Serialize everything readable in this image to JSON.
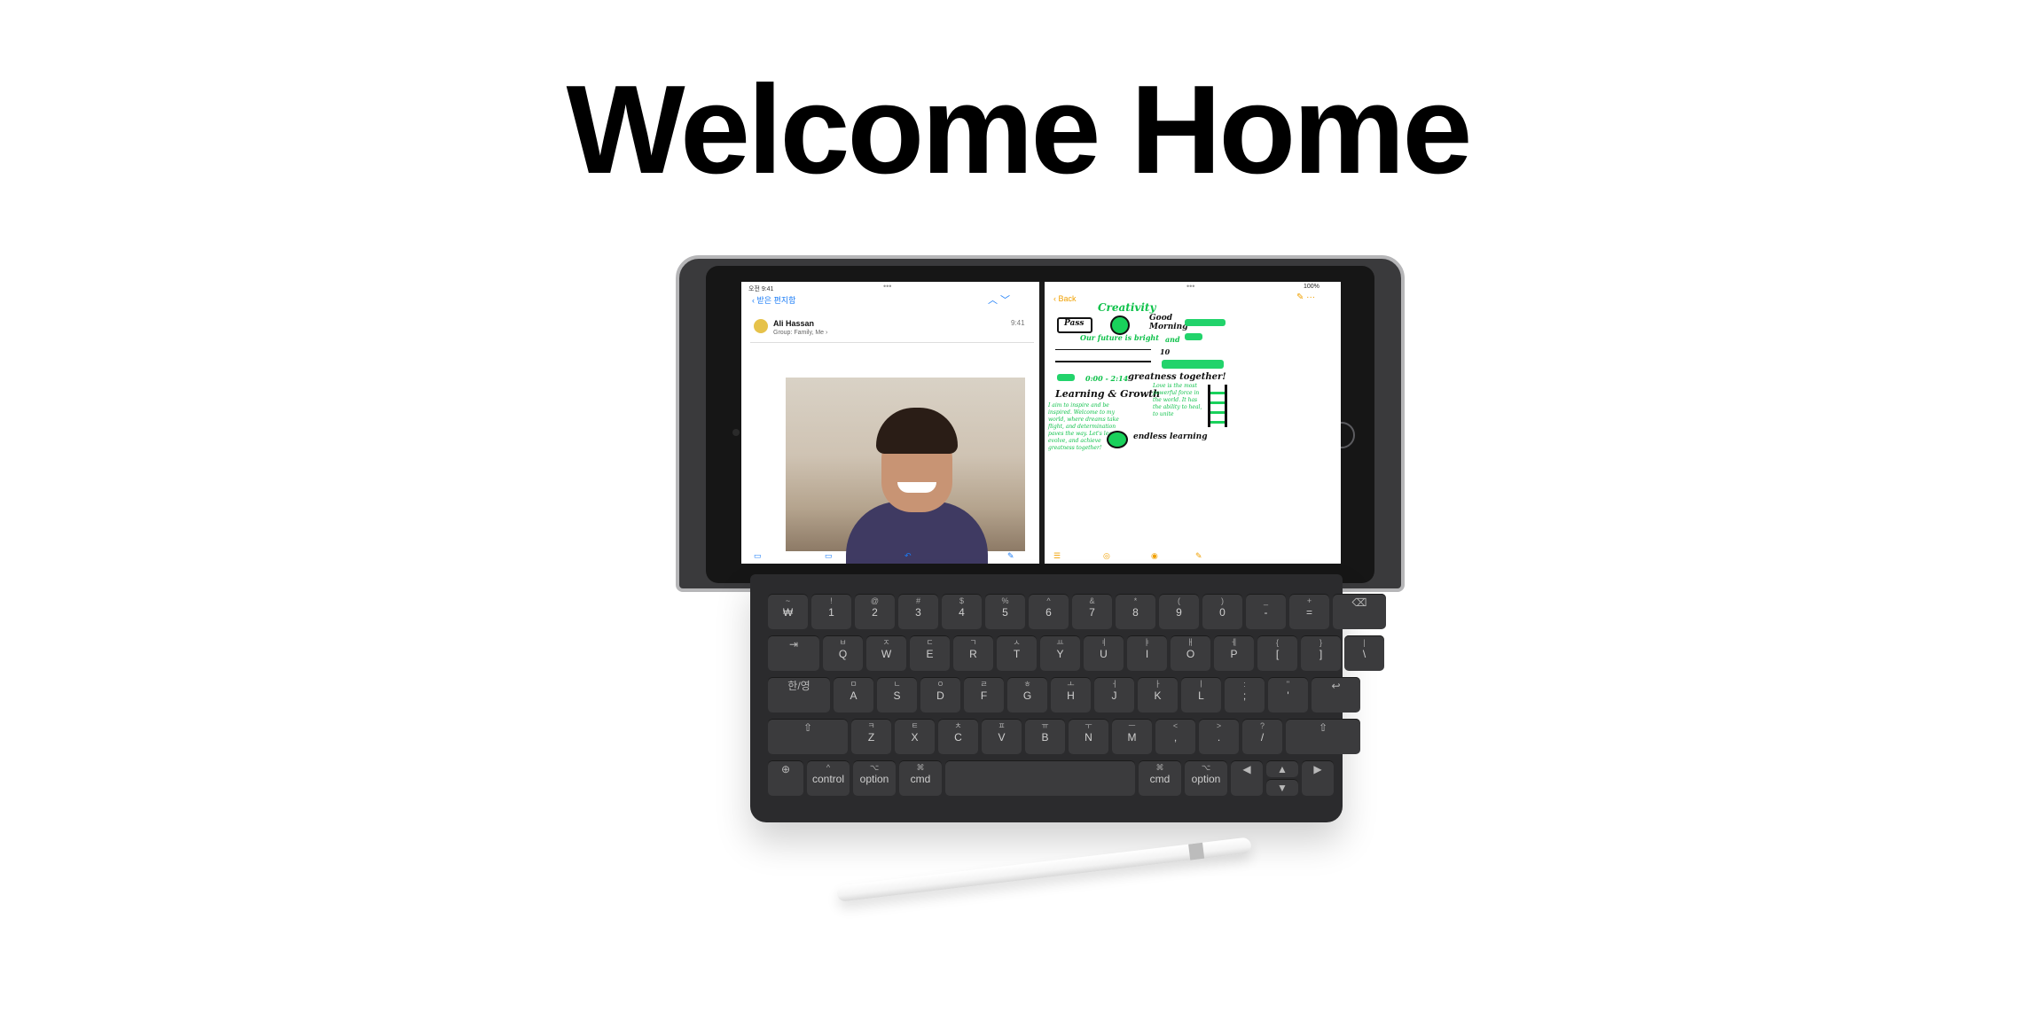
{
  "page": {
    "title": "Welcome Home"
  },
  "mail": {
    "status_time": "오전 9:41",
    "dots": "•••",
    "back_label": "받은 편지함",
    "nav_icons": "︿  ﹀",
    "sender": "Ali Hassan",
    "group": "Group: Family, Me  ›",
    "time": "9:41",
    "toolbar_icons": [
      "folder-icon",
      "archive-icon",
      "reply-icon",
      "compose-icon"
    ]
  },
  "notes": {
    "dots": "•••",
    "battery": "100%",
    "back_label": "Back",
    "icons": "✎  ···",
    "sketch": {
      "creativity": "Creativity",
      "pass": "Pass",
      "good_morning": "Good\nMorning",
      "future": "Our future is bright",
      "and": "and",
      "ten": "10",
      "schedule": "0:00 - 2:14",
      "greatness": "greatness together!",
      "learning": "Learning & Growth",
      "love": "Love is the most powerful force in the world. It has the ability to heal, to unite",
      "paragraph": "I aim to inspire and be inspired. Welcome to my world, where dreams take flight, and determination paves the way. Let's learn, evolve, and achieve greatness together!",
      "endless": "endless learning"
    }
  },
  "keyboard": {
    "rows": [
      [
        [
          "~",
          "₩"
        ],
        [
          "!",
          "1"
        ],
        [
          "@",
          "2"
        ],
        [
          "#",
          "3"
        ],
        [
          "$",
          "4"
        ],
        [
          "%",
          "5"
        ],
        [
          "^",
          "6"
        ],
        [
          "&",
          "7"
        ],
        [
          "*",
          "8"
        ],
        [
          "(",
          "9"
        ],
        [
          ")",
          "0"
        ],
        [
          "_",
          "-"
        ],
        [
          "+",
          "="
        ]
      ],
      [
        [
          "ㅂ",
          "Q"
        ],
        [
          "ㅈ",
          "W"
        ],
        [
          "ㄷ",
          "E"
        ],
        [
          "ㄱ",
          "R"
        ],
        [
          "ㅅ",
          "T"
        ],
        [
          "ㅛ",
          "Y"
        ],
        [
          "ㅕ",
          "U"
        ],
        [
          "ㅑ",
          "I"
        ],
        [
          "ㅐ",
          "O"
        ],
        [
          "ㅔ",
          "P"
        ],
        [
          "{",
          "["
        ],
        [
          "}",
          "]"
        ],
        [
          "|",
          "\\"
        ]
      ],
      [
        [
          "ㅁ",
          "A"
        ],
        [
          "ㄴ",
          "S"
        ],
        [
          "ㅇ",
          "D"
        ],
        [
          "ㄹ",
          "F"
        ],
        [
          "ㅎ",
          "G"
        ],
        [
          "ㅗ",
          "H"
        ],
        [
          "ㅓ",
          "J"
        ],
        [
          "ㅏ",
          "K"
        ],
        [
          "ㅣ",
          "L"
        ],
        [
          ":",
          ";"
        ],
        [
          "\"",
          "'"
        ]
      ],
      [
        [
          "ㅋ",
          "Z"
        ],
        [
          "ㅌ",
          "X"
        ],
        [
          "ㅊ",
          "C"
        ],
        [
          "ㅍ",
          "V"
        ],
        [
          "ㅠ",
          "B"
        ],
        [
          "ㅜ",
          "N"
        ],
        [
          "ㅡ",
          "M"
        ],
        [
          "<",
          ","
        ],
        [
          ">",
          "."
        ],
        [
          "?",
          "/"
        ]
      ]
    ],
    "mods": {
      "tab": "⇥",
      "capslock": "한/영",
      "return": "↩",
      "delete": "⌫",
      "shift_left": "⇧",
      "shift_right": "⇧",
      "globe": "⊕",
      "control_sym": "^",
      "control": "control",
      "option_sym": "⌥",
      "option": "option",
      "cmd_sym": "⌘",
      "cmd": "cmd",
      "left": "◀",
      "up": "▲",
      "down": "▼",
      "right": "▶"
    }
  }
}
